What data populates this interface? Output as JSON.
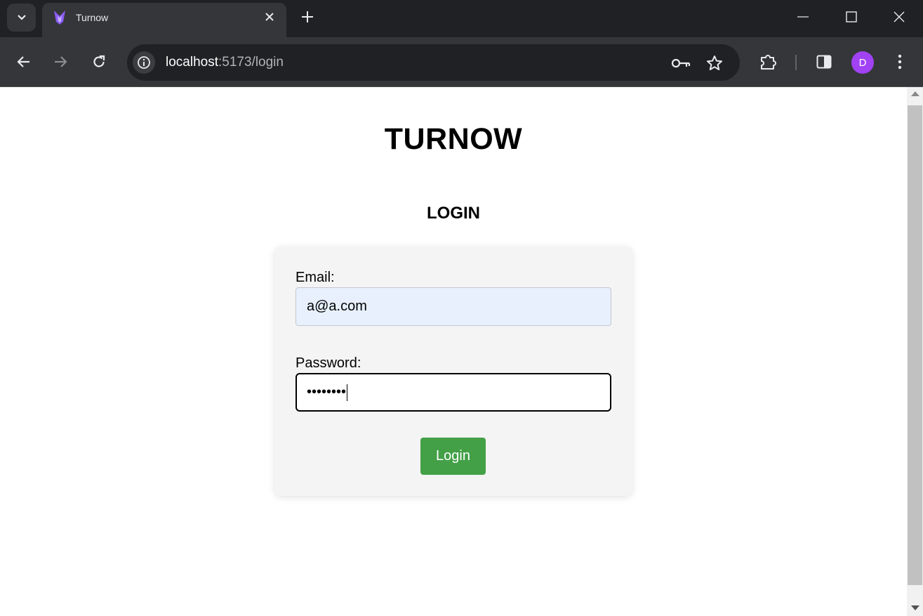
{
  "browser": {
    "tab": {
      "title": "Turnow"
    },
    "url": {
      "host": "localhost",
      "path": ":5173/login"
    },
    "profile_initial": "D",
    "icons": {
      "tab_search": "chevron-down-icon",
      "tab_close": "close-icon",
      "new_tab": "plus-icon",
      "minimize": "minimize-icon",
      "maximize": "maximize-icon",
      "window_close": "close-icon",
      "back": "arrow-left-icon",
      "forward": "arrow-right-icon",
      "reload": "reload-icon",
      "site_info": "info-icon",
      "password_key": "key-icon",
      "bookmark": "star-icon",
      "extensions": "puzzle-icon",
      "side_panel": "side-panel-icon",
      "menu": "kebab-menu-icon"
    }
  },
  "page": {
    "brand": "TURNOW",
    "heading": "LOGIN",
    "form": {
      "email_label": "Email:",
      "email_value": "a@a.com",
      "password_label": "Password:",
      "password_value": "••••••••",
      "submit_label": "Login"
    }
  },
  "colors": {
    "button_bg": "#43a047",
    "email_autofill_bg": "#e8f0fe",
    "card_bg": "#f4f4f4",
    "avatar_bg": "#a142f4"
  }
}
